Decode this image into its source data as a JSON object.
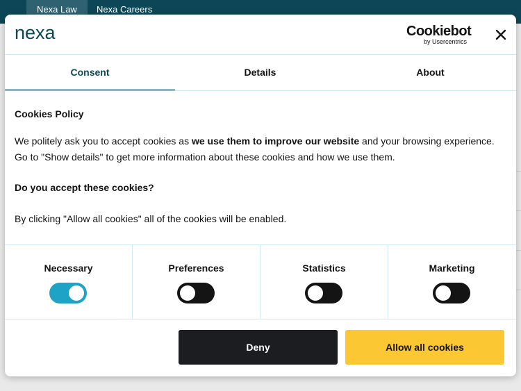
{
  "site": {
    "tabs": [
      {
        "label": "Nexa Law"
      },
      {
        "label": "Nexa Careers"
      }
    ]
  },
  "dialog": {
    "logo_text": "nexa",
    "cookiebot": {
      "name": "Cookiebot",
      "byline": "by Usercentrics"
    },
    "tabs": [
      {
        "label": "Consent"
      },
      {
        "label": "Details"
      },
      {
        "label": "About"
      }
    ],
    "content": {
      "heading": "Cookies Policy",
      "intro_start": "We politely ask you to accept cookies as ",
      "intro_bold": "we use them to improve our website",
      "intro_end": " and your browsing experience. Go to \"Show details\" to get more information about these cookies and how we use them.",
      "question": "Do you accept these cookies?",
      "note": "By clicking \"Allow all cookies\" all of the cookies will be enabled."
    },
    "toggles": [
      {
        "label": "Necessary",
        "enabled": true
      },
      {
        "label": "Preferences",
        "enabled": false
      },
      {
        "label": "Statistics",
        "enabled": false
      },
      {
        "label": "Marketing",
        "enabled": false
      }
    ],
    "buttons": {
      "deny": "Deny",
      "allow_all": "Allow all cookies"
    }
  },
  "colors": {
    "site_bar": "#0d4757",
    "accent_toggle": "#1ea2c6",
    "allow_button": "#fbc732",
    "deny_button": "#1c1d20"
  }
}
